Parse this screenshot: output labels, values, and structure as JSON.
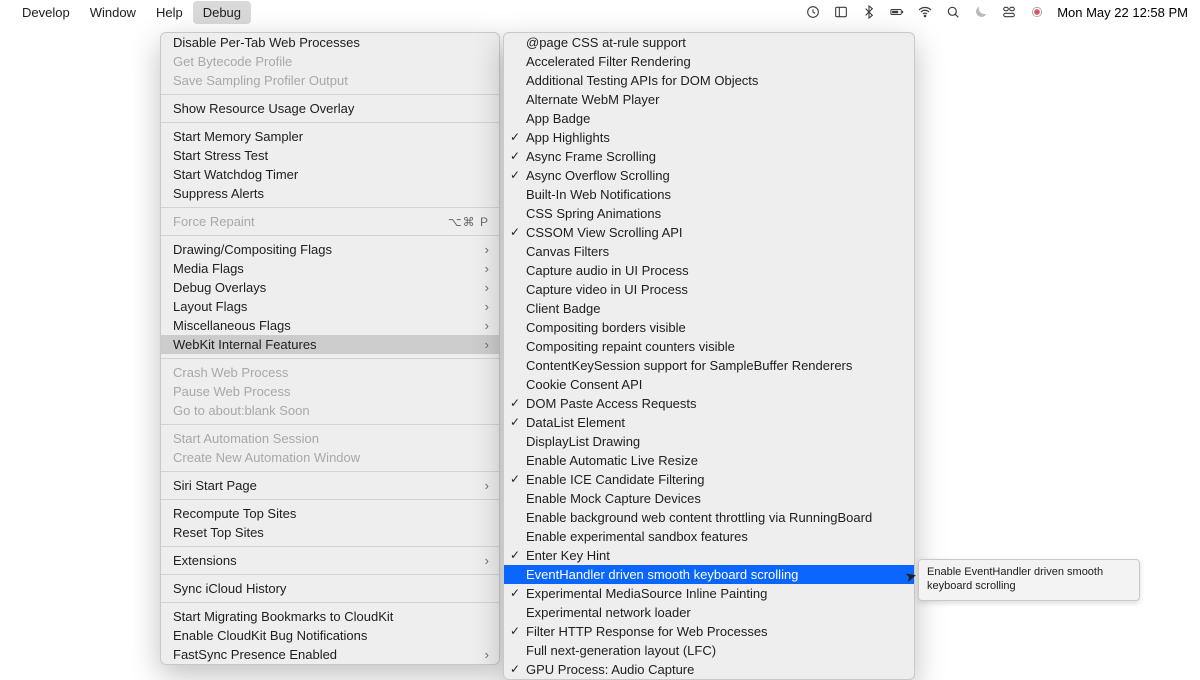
{
  "menubar": {
    "items": [
      "Develop",
      "Window",
      "Help",
      "Debug"
    ],
    "active_index": 3
  },
  "status": {
    "icons": [
      "time-machine-icon",
      "sidebar-icon",
      "bluetooth-icon",
      "battery-icon",
      "wifi-icon",
      "search-icon",
      "moon-icon",
      "control-center-icon",
      "siri-icon"
    ],
    "datetime": "Mon May 22  12:58 PM"
  },
  "menu1": [
    {
      "t": "item",
      "label": "Disable Per-Tab Web Processes"
    },
    {
      "t": "item",
      "label": "Get Bytecode Profile",
      "disabled": true
    },
    {
      "t": "item",
      "label": "Save Sampling Profiler Output",
      "disabled": true
    },
    {
      "t": "sep"
    },
    {
      "t": "item",
      "label": "Show Resource Usage Overlay"
    },
    {
      "t": "sep"
    },
    {
      "t": "item",
      "label": "Start Memory Sampler"
    },
    {
      "t": "item",
      "label": "Start Stress Test"
    },
    {
      "t": "item",
      "label": "Start Watchdog Timer"
    },
    {
      "t": "item",
      "label": "Suppress Alerts"
    },
    {
      "t": "sep"
    },
    {
      "t": "item",
      "label": "Force Repaint",
      "disabled": true,
      "shortcut": "⌥⌘ P"
    },
    {
      "t": "sep"
    },
    {
      "t": "sub",
      "label": "Drawing/Compositing Flags"
    },
    {
      "t": "sub",
      "label": "Media Flags"
    },
    {
      "t": "sub",
      "label": "Debug Overlays"
    },
    {
      "t": "sub",
      "label": "Layout Flags"
    },
    {
      "t": "sub",
      "label": "Miscellaneous Flags"
    },
    {
      "t": "sub",
      "label": "WebKit Internal Features",
      "active": true
    },
    {
      "t": "sep"
    },
    {
      "t": "item",
      "label": "Crash Web Process",
      "disabled": true
    },
    {
      "t": "item",
      "label": "Pause Web Process",
      "disabled": true
    },
    {
      "t": "item",
      "label": "Go to about:blank Soon",
      "disabled": true
    },
    {
      "t": "sep"
    },
    {
      "t": "item",
      "label": "Start Automation Session",
      "disabled": true
    },
    {
      "t": "item",
      "label": "Create New Automation Window",
      "disabled": true
    },
    {
      "t": "sep"
    },
    {
      "t": "sub",
      "label": "Siri Start Page"
    },
    {
      "t": "sep"
    },
    {
      "t": "item",
      "label": "Recompute Top Sites"
    },
    {
      "t": "item",
      "label": "Reset Top Sites"
    },
    {
      "t": "sep"
    },
    {
      "t": "sub",
      "label": "Extensions"
    },
    {
      "t": "sep"
    },
    {
      "t": "item",
      "label": "Sync iCloud History"
    },
    {
      "t": "sep"
    },
    {
      "t": "item",
      "label": "Start Migrating Bookmarks to CloudKit"
    },
    {
      "t": "item",
      "label": "Enable CloudKit Bug Notifications"
    },
    {
      "t": "sub",
      "label": "FastSync Presence Enabled"
    }
  ],
  "menu2": [
    {
      "label": "@page CSS at-rule support"
    },
    {
      "label": "Accelerated Filter Rendering"
    },
    {
      "label": "Additional Testing APIs for DOM Objects"
    },
    {
      "label": "Alternate WebM Player"
    },
    {
      "label": "App Badge"
    },
    {
      "label": "App Highlights",
      "checked": true
    },
    {
      "label": "Async Frame Scrolling",
      "checked": true
    },
    {
      "label": "Async Overflow Scrolling",
      "checked": true
    },
    {
      "label": "Built-In Web Notifications"
    },
    {
      "label": "CSS Spring Animations"
    },
    {
      "label": "CSSOM View Scrolling API",
      "checked": true
    },
    {
      "label": "Canvas Filters"
    },
    {
      "label": "Capture audio in UI Process"
    },
    {
      "label": "Capture video in UI Process"
    },
    {
      "label": "Client Badge"
    },
    {
      "label": "Compositing borders visible"
    },
    {
      "label": "Compositing repaint counters visible"
    },
    {
      "label": "ContentKeySession support for SampleBuffer Renderers"
    },
    {
      "label": "Cookie Consent API"
    },
    {
      "label": "DOM Paste Access Requests",
      "checked": true
    },
    {
      "label": "DataList Element",
      "checked": true
    },
    {
      "label": "DisplayList Drawing"
    },
    {
      "label": "Enable Automatic Live Resize"
    },
    {
      "label": "Enable ICE Candidate Filtering",
      "checked": true
    },
    {
      "label": "Enable Mock Capture Devices"
    },
    {
      "label": "Enable background web content throttling via RunningBoard"
    },
    {
      "label": "Enable experimental sandbox features"
    },
    {
      "label": "Enter Key Hint",
      "checked": true
    },
    {
      "label": "EventHandler driven smooth keyboard scrolling",
      "highlight": true
    },
    {
      "label": "Experimental MediaSource Inline Painting",
      "checked": true
    },
    {
      "label": "Experimental network loader"
    },
    {
      "label": "Filter HTTP Response for Web Processes",
      "checked": true
    },
    {
      "label": "Full next-generation layout (LFC)"
    },
    {
      "label": "GPU Process: Audio Capture",
      "checked": true
    }
  ],
  "tooltip": "Enable EventHandler driven smooth keyboard scrolling"
}
